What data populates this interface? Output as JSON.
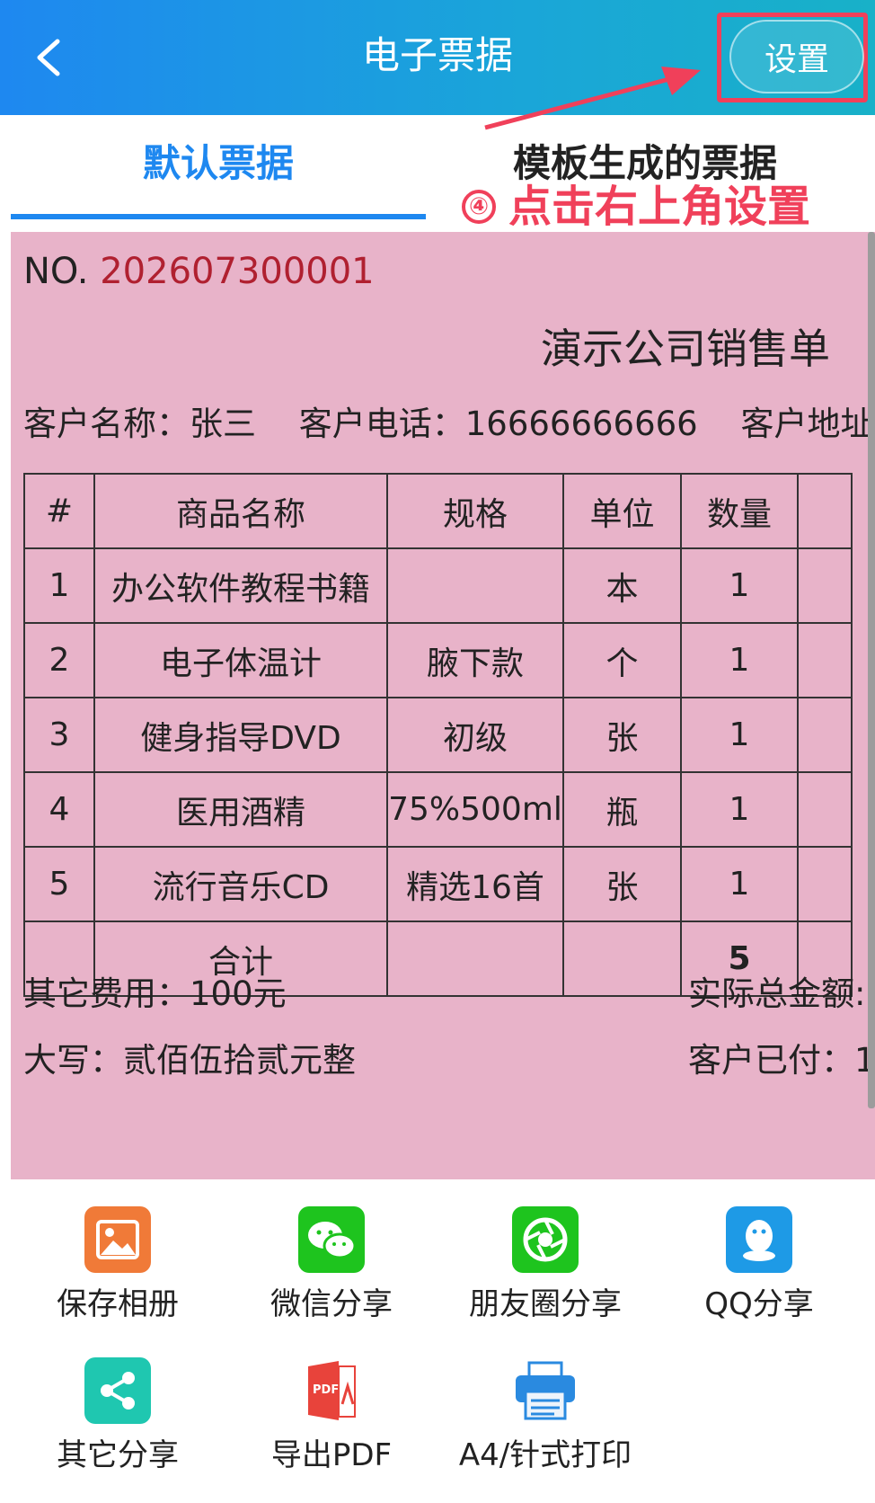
{
  "header": {
    "title": "电子票据",
    "settings_label": "设置"
  },
  "tabs": [
    {
      "label": "默认票据",
      "active": true
    },
    {
      "label": "模板生成的票据",
      "active": false
    }
  ],
  "annotation": {
    "number": "④",
    "text": "点击右上角设置"
  },
  "receipt": {
    "no_label": "NO.",
    "no_value": "202607300001",
    "company_title": "演示公司销售单",
    "customer_name": "客户名称：张三",
    "customer_phone": "客户电话：16666666666",
    "customer_address": "客户地址",
    "columns": [
      "#",
      "商品名称",
      "规格",
      "单位",
      "数量"
    ],
    "rows": [
      {
        "idx": "1",
        "name": "办公软件教程书籍",
        "spec": "",
        "unit": "本",
        "qty": "1"
      },
      {
        "idx": "2",
        "name": "电子体温计",
        "spec": "腋下款",
        "unit": "个",
        "qty": "1"
      },
      {
        "idx": "3",
        "name": "健身指导DVD",
        "spec": "初级",
        "unit": "张",
        "qty": "1"
      },
      {
        "idx": "4",
        "name": "医用酒精",
        "spec": "75%500ml",
        "unit": "瓶",
        "qty": "1"
      },
      {
        "idx": "5",
        "name": "流行音乐CD",
        "spec": "精选16首",
        "unit": "张",
        "qty": "1"
      }
    ],
    "total_label": "合计",
    "total_qty": "5",
    "other_fees": "其它费用：100元",
    "actual_total": "实际总金额:",
    "amount_in_words": "大写：贰佰伍拾贰元整",
    "customer_paid": "客户已付：1"
  },
  "share": {
    "items": [
      {
        "label": "保存相册",
        "icon": "album-icon",
        "color": "#f07a38"
      },
      {
        "label": "微信分享",
        "icon": "wechat-icon",
        "color": "#1ec41e"
      },
      {
        "label": "朋友圈分享",
        "icon": "moments-icon",
        "color": "#1ec41e"
      },
      {
        "label": "QQ分享",
        "icon": "qq-icon",
        "color": "#1e9ae6"
      },
      {
        "label": "其它分享",
        "icon": "share-icon",
        "color": "#1fc7b0"
      },
      {
        "label": "导出PDF",
        "icon": "pdf-icon",
        "color": "#e8433b"
      },
      {
        "label": "A4/针式打印",
        "icon": "printer-icon",
        "color": "#2a8ae0"
      }
    ]
  },
  "colors": {
    "header_gradient_start": "#1e88f0",
    "header_gradient_end": "#18b1c8",
    "receipt_bg": "#e8b3c9",
    "annotation_red": "#f0405a",
    "receipt_no_red": "#b02030",
    "tab_active_blue": "#1e88f0"
  }
}
